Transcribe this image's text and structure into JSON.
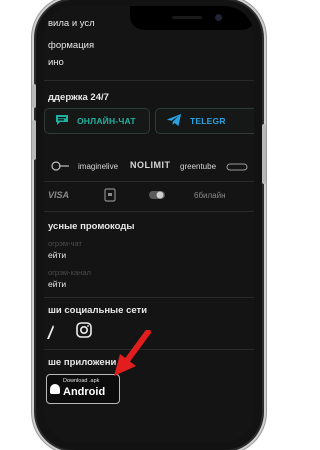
{
  "menu": {
    "rules": "вила и усл",
    "info": "формация",
    "casino": "ино"
  },
  "support": {
    "title": "ддержка 24/7",
    "chat_label": "ОНЛАЙН-ЧАТ",
    "telegram_label": "TELEGR"
  },
  "providers": [
    "imaginelive",
    "NOLIMIT",
    "greentube"
  ],
  "payments": [
    "VISA",
    "6билайн"
  ],
  "promos": {
    "title": "усные промокоды",
    "items": [
      {
        "caption": "огрэм-чат",
        "action": "ейти"
      },
      {
        "caption": "огрэм-канал",
        "action": "ейти"
      }
    ]
  },
  "social": {
    "title": "ши социальные сети"
  },
  "apps": {
    "title": "ше приложени",
    "apk_line1": "Download .apk",
    "apk_line2": "Android"
  },
  "colors": {
    "accent": "#1fb2a0",
    "telegram": "#2aa1e0",
    "arrow": "#e11d1d"
  }
}
